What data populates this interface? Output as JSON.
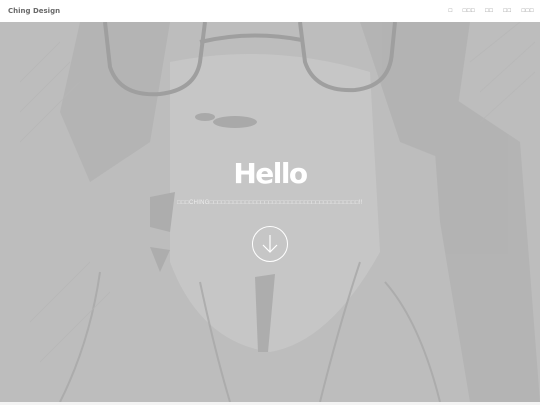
{
  "header": {
    "brand": "Ching Design",
    "nav": [
      "□",
      "□□□",
      "□□",
      "□□",
      "□□□"
    ]
  },
  "hero": {
    "title": "Hello",
    "subtitle": "□□□CHING□□□□□□□□□□□□□□□□□□□□□□□□□□□□□□□□□□□□□□!!",
    "scroll_icon": "arrow-down-icon",
    "overlay_color": "#bdbdbd"
  }
}
